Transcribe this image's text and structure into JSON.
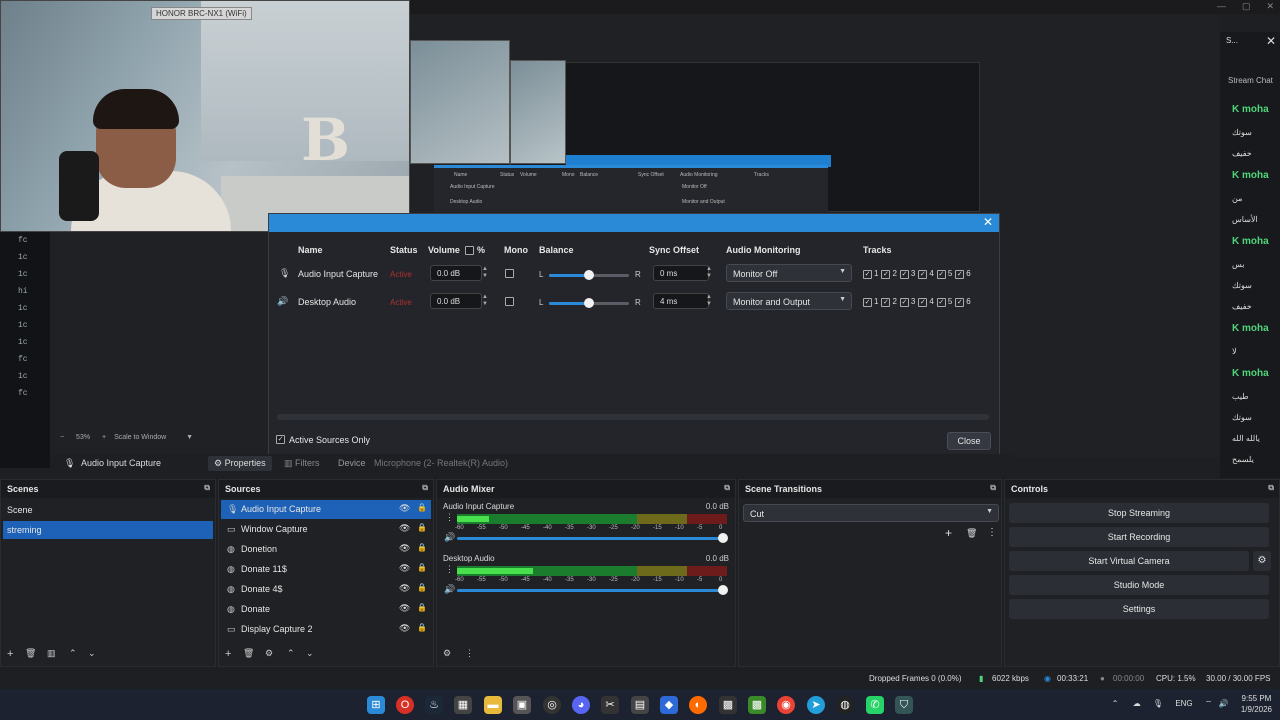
{
  "camera": {
    "label": "HONOR BRC-NX1 (WiFi)"
  },
  "left_strip": [
    "fc",
    "1c",
    "1c",
    "hi",
    "1c",
    "1c",
    "1c",
    "fc",
    "1c",
    "fc"
  ],
  "nested": {
    "headers": [
      "Name",
      "Status",
      "Volume",
      "Mono",
      "Balance",
      "Sync Offset",
      "Audio Monitoring",
      "Tracks"
    ],
    "rows": [
      "Audio Input Capture",
      "Desktop Audio"
    ],
    "monitoring": [
      "Monitor Off",
      "Monitor and Output"
    ]
  },
  "chat": {
    "header": "S...",
    "title": "Stream Chat",
    "rows": [
      {
        "t": "moha",
        "u": true
      },
      {
        "t": "سوتك",
        "u": false
      },
      {
        "t": "خفيف",
        "u": false
      },
      {
        "t": "moha",
        "u": true
      },
      {
        "t": "من",
        "u": false
      },
      {
        "t": "الأساس",
        "u": false
      },
      {
        "t": "moha",
        "u": true
      },
      {
        "t": "بس",
        "u": false
      },
      {
        "t": "سوتك",
        "u": false
      },
      {
        "t": "خفيف",
        "u": false
      },
      {
        "t": "moha",
        "u": true
      },
      {
        "t": "لا",
        "u": false
      },
      {
        "t": "moha",
        "u": true
      },
      {
        "t": "طيب",
        "u": false
      },
      {
        "t": "سوتك",
        "u": false
      },
      {
        "t": "يالله الله",
        "u": false
      },
      {
        "t": "يلسمح",
        "u": false
      }
    ]
  },
  "dialog": {
    "headers": {
      "name": "Name",
      "status": "Status",
      "volume": "Volume",
      "percent": "%",
      "mono": "Mono",
      "balance": "Balance",
      "sync": "Sync Offset",
      "monitoring": "Audio Monitoring",
      "tracks": "Tracks"
    },
    "rows": [
      {
        "name": "Audio Input Capture",
        "status": "Active",
        "volume": "0.0 dB",
        "balance_l": "L",
        "balance_r": "R",
        "sync": "0 ms",
        "monitoring": "Monitor Off"
      },
      {
        "name": "Desktop Audio",
        "status": "Active",
        "volume": "0.0 dB",
        "balance_l": "L",
        "balance_r": "R",
        "sync": "4 ms",
        "monitoring": "Monitor and Output"
      }
    ],
    "balance_position": 0.5,
    "track_labels": [
      "1",
      "2",
      "3",
      "4",
      "5",
      "6"
    ],
    "active_only": "Active Sources Only",
    "close": "Close"
  },
  "preview_bar": {
    "zoom": "53%",
    "scale": "Scale to Window"
  },
  "source_bar": {
    "source": "Audio Input Capture",
    "properties": "Properties",
    "filters": "Filters",
    "device": "Device",
    "device_value": "Microphone (2- Realtek(R) Audio)"
  },
  "scenes": {
    "title": "Scenes",
    "items": [
      "Scene",
      "streming"
    ],
    "selected": 1
  },
  "sources": {
    "title": "Sources",
    "items": [
      {
        "name": "Audio Input Capture",
        "icon": "mic-icon"
      },
      {
        "name": "Window Capture",
        "icon": "window-icon"
      },
      {
        "name": "Donetion",
        "icon": "browser-icon"
      },
      {
        "name": "Donate 11$",
        "icon": "browser-icon"
      },
      {
        "name": "Donate 4$",
        "icon": "browser-icon"
      },
      {
        "name": "Donate",
        "icon": "browser-icon"
      },
      {
        "name": "Display Capture 2",
        "icon": "monitor-icon"
      }
    ]
  },
  "mixer": {
    "title": "Audio Mixer",
    "channels": [
      {
        "name": "Audio Input Capture",
        "db": "0.0 dB",
        "level": 0.12
      },
      {
        "name": "Desktop Audio",
        "db": "0.0 dB",
        "level": 0.28
      }
    ],
    "scale": [
      "-60",
      "-55",
      "-50",
      "-45",
      "-40",
      "-35",
      "-30",
      "-25",
      "-20",
      "-15",
      "-10",
      "-5",
      "0"
    ]
  },
  "transitions": {
    "title": "Scene Transitions",
    "value": "Cut"
  },
  "controls": {
    "title": "Controls",
    "buttons": [
      "Stop Streaming",
      "Start Recording",
      "Start Virtual Camera",
      "Studio Mode",
      "Settings"
    ]
  },
  "status": {
    "dropped": "Dropped Frames 0 (0.0%)",
    "kbps": "6022 kbps",
    "stream_time": "00:33:21",
    "rec_time": "00:00:00",
    "cpu": "CPU: 1.5%",
    "fps": "30.00 / 30.00 FPS"
  },
  "tray": {
    "lang": "ENG",
    "time": "9:55 PM",
    "date": "1/9/2026"
  },
  "colors": {
    "accent": "#2b8ad8",
    "selected": "#1e62b8",
    "active_status": "#b03030",
    "chat_user": "#4fd67a"
  }
}
